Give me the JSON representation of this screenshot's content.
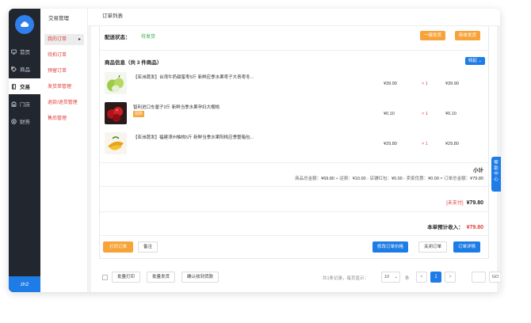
{
  "sidebar": {
    "items": [
      {
        "label": "首页",
        "icon": "monitor-icon"
      },
      {
        "label": "商品",
        "icon": "tag-icon"
      },
      {
        "label": "交易",
        "icon": "book-icon"
      },
      {
        "label": "门店",
        "icon": "store-icon"
      },
      {
        "label": "财务",
        "icon": "coin-icon"
      }
    ],
    "user": "zh2"
  },
  "submenu": {
    "title": "交易管理",
    "items": [
      "我的订单",
      "待拍订单",
      "预留订单",
      "发货单管理",
      "退款/退货管理",
      "售后管理"
    ]
  },
  "tabs": {
    "active": "订单列表"
  },
  "order": {
    "status_label": "配送状态：",
    "status_value": "待发货",
    "btn_ship_all": "一键发货",
    "btn_new_ship": "新单发货",
    "products_title": "商品信息（共 3 件商品）",
    "collapse_label": "收起",
    "products": [
      {
        "name": "【亚洲蔬发】台湾牛奶甜蜜枣5斤 新鲜应季水果枣子大青枣冬...",
        "tag": "",
        "price": "¥39.90",
        "qty": "× 1",
        "total": "¥39.90"
      },
      {
        "name": "智利进口车厘子2斤 新鲜当季水果孕妇大樱桃",
        "tag": "团购",
        "price": "¥0.10",
        "qty": "× 1",
        "total": "¥0.10"
      },
      {
        "name": "【亚洲蔬发】福建漳州柚桃5斤 新鲜当季水果阳桃应季整箱包...",
        "tag": "",
        "price": "¥29.80",
        "qty": "× 1",
        "total": "¥29.80"
      }
    ],
    "subtotal_title": "小计",
    "summary_parts": [
      "商品总金额：",
      "¥69.80",
      " + 运费：",
      "¥10.00",
      " - 店铺红包：",
      "¥0.00",
      " - 卖家优惠：",
      "¥0.00",
      " = 订单总金额：",
      "¥79.80"
    ],
    "unpaid_label": "[未支付]",
    "unpaid_amount": "¥79.80",
    "income_label": "本单预计收入：",
    "income_amount": "¥79.80",
    "btn_print": "打印订单",
    "btn_note": "备注",
    "btn_edit_price": "修改订单价格",
    "btn_close": "关闭订单",
    "btn_detail": "订单详情"
  },
  "bottom": {
    "btn_batch_print": "批量打印",
    "btn_batch_ship": "批量发货",
    "btn_confirm_receive": "确认收到货款",
    "total_text": "共1条记录，每页显示：",
    "page_size": "10",
    "unit": "条",
    "prev": "<",
    "current_page": "1",
    "next": ">",
    "go": "GO"
  },
  "help_float": "帮助中心",
  "colors": {
    "accent": "#1e7ce6",
    "orange": "#f8a33a",
    "red": "#e23c3c",
    "sidebar": "#22262f",
    "green": "#39a844"
  }
}
